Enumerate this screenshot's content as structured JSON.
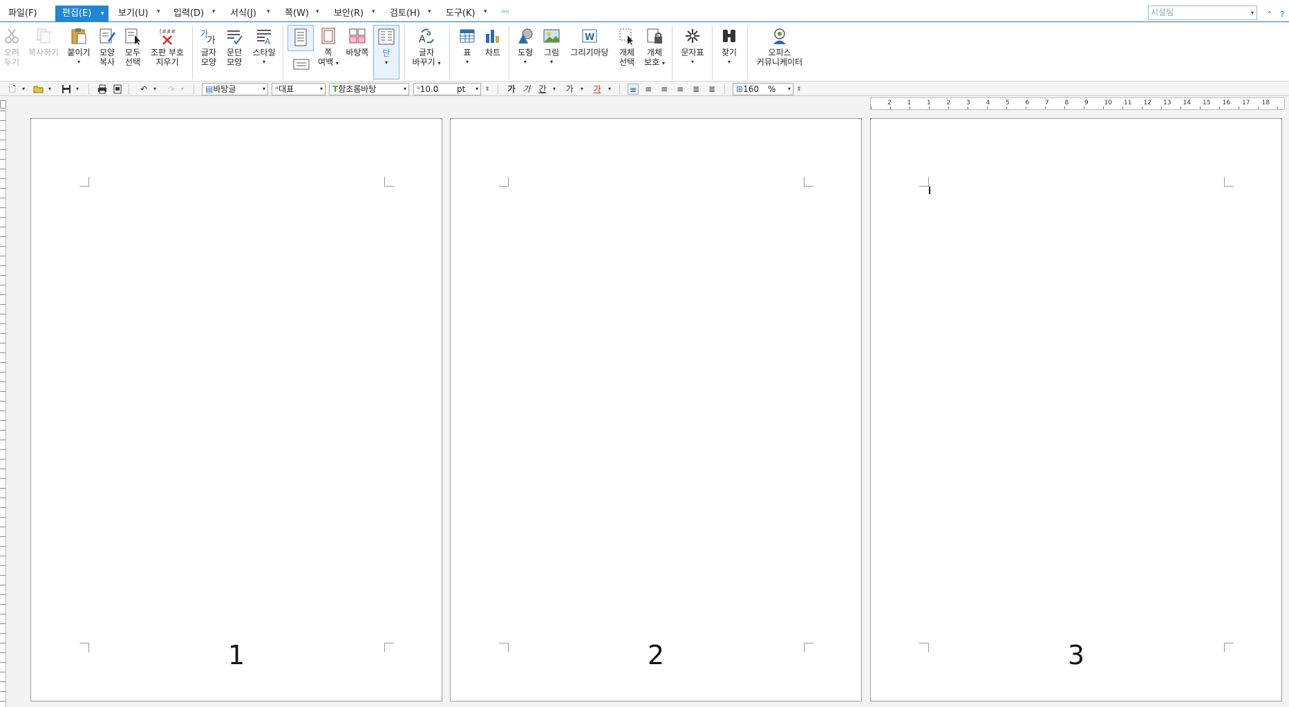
{
  "menu": {
    "items": [
      {
        "label": "파일(F)"
      },
      {
        "label": "편집(E)"
      },
      {
        "label": "보기(U)"
      },
      {
        "label": "입력(D)"
      },
      {
        "label": "서식(J)"
      },
      {
        "label": "쪽(W)"
      },
      {
        "label": "보안(R)"
      },
      {
        "label": "검토(H)"
      },
      {
        "label": "도구(K)"
      }
    ],
    "search_placeholder": "시설팀"
  },
  "ribbon": {
    "cut": "오려\n두기",
    "copy": "복사하기",
    "paste": "붙이기",
    "format_copy": "모양\n복사",
    "select_all": "모두\n선택",
    "clear_marks": "조판 부호\n지우기",
    "char_shape": "글자\n모양",
    "para_shape": "문단\n모양",
    "style": "스타일",
    "page_margin": "쪽\n여백",
    "background": "바탕쪽",
    "columns": "단",
    "char_replace": "글자\n바꾸기",
    "table": "표",
    "chart": "차트",
    "shape": "도형",
    "picture": "그림",
    "drawing_mart": "그리기마당",
    "obj_select": "개체\n선택",
    "obj_protect": "개체\n보호",
    "symbol": "문자표",
    "find": "찾기",
    "office_comm": "오피스\n커뮤니케이터"
  },
  "format": {
    "style": "바탕글",
    "lang": "대표",
    "font": "함초롬바탕",
    "size": "10.0",
    "unit": "pt",
    "zoom": "160",
    "zoom_unit": "%"
  },
  "ruler": [
    "2",
    "1",
    "1",
    "2",
    "3",
    "4",
    "5",
    "6",
    "7",
    "8",
    "9",
    "10",
    "11",
    "12",
    "13",
    "14",
    "15",
    "16",
    "17",
    "18"
  ],
  "pages": [
    {
      "number": "1"
    },
    {
      "number": "2"
    },
    {
      "number": "3"
    }
  ],
  "colors": {
    "accent": "#1f86d6"
  }
}
